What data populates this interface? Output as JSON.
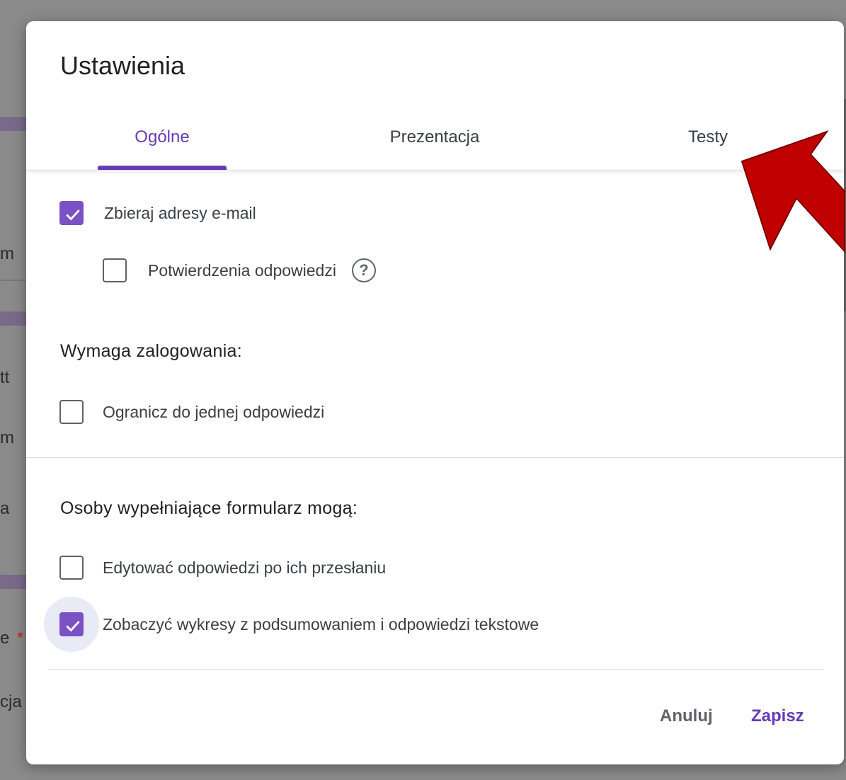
{
  "dialog": {
    "title": "Ustawienia",
    "tabs": [
      {
        "label": "Ogólne",
        "active": true
      },
      {
        "label": "Prezentacja",
        "active": false
      },
      {
        "label": "Testy",
        "active": false
      }
    ],
    "options": {
      "collect_emails": {
        "label": "Zbieraj adresy e-mail",
        "checked": true
      },
      "response_receipts": {
        "label": "Potwierdzenia odpowiedzi",
        "checked": false
      },
      "limit_one_response": {
        "label": "Ogranicz do jednej odpowiedzi",
        "checked": false
      },
      "edit_after_submit": {
        "label": "Edytować odpowiedzi po ich przesłaniu",
        "checked": false
      },
      "see_summary": {
        "label": "Zobaczyć wykresy z podsumowaniem i odpowiedzi tekstowe",
        "checked": true
      }
    },
    "sections": {
      "requires_signin": "Wymaga zalogowania:",
      "respondents_can": "Osoby wypełniające formularz mogą:"
    },
    "buttons": {
      "cancel": "Anuluj",
      "save": "Zapisz"
    }
  },
  "background": {
    "fragments": [
      "m",
      "tt",
      "m",
      "a",
      "e",
      "*",
      "cja"
    ]
  },
  "colors": {
    "accent": "#673ab7",
    "checkbox_checked": "#7b52c4",
    "annotation_arrow": "#c00000"
  },
  "icons": {
    "help": "question-circle-icon",
    "check": "checkmark-icon",
    "annotation": "red-arrow-icon"
  }
}
